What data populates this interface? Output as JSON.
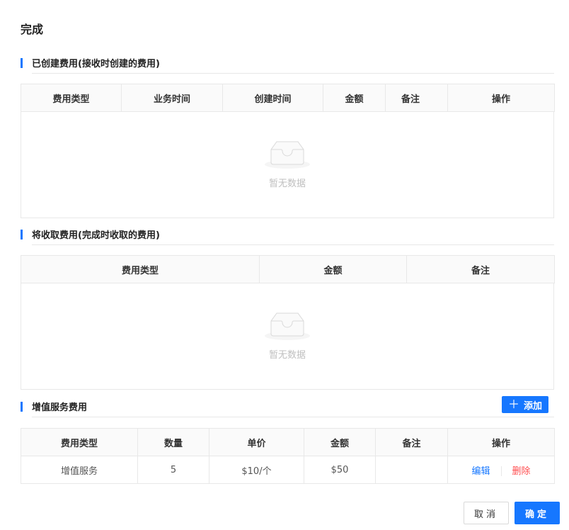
{
  "title": "完成",
  "created_section": {
    "label": "已创建费用(接收时创建的费用)",
    "headers": [
      "费用类型",
      "业务时间",
      "创建时间",
      "金额",
      "备注",
      "操作"
    ],
    "empty_text": "暂无数据"
  },
  "collect_section": {
    "label": "将收取费用(完成时收取的费用)",
    "headers": [
      "费用类型",
      "金额",
      "备注"
    ],
    "empty_text": "暂无数据"
  },
  "vas_section": {
    "label": "增值服务费用",
    "add_label": "添加",
    "headers": [
      "费用类型",
      "数量",
      "单价",
      "金额",
      "备注",
      "操作"
    ],
    "rows": [
      {
        "type": "增值服务",
        "qty": "5",
        "price": "$10/个",
        "amount": "$50",
        "note": "",
        "edit": "编辑",
        "delete": "删除"
      }
    ]
  },
  "footer": {
    "cancel": "取消",
    "ok": "确定"
  },
  "colors": {
    "primary": "#1677ff",
    "danger": "#ff4d4f",
    "border": "#e8e8e8",
    "header_bg": "#fafafa"
  }
}
